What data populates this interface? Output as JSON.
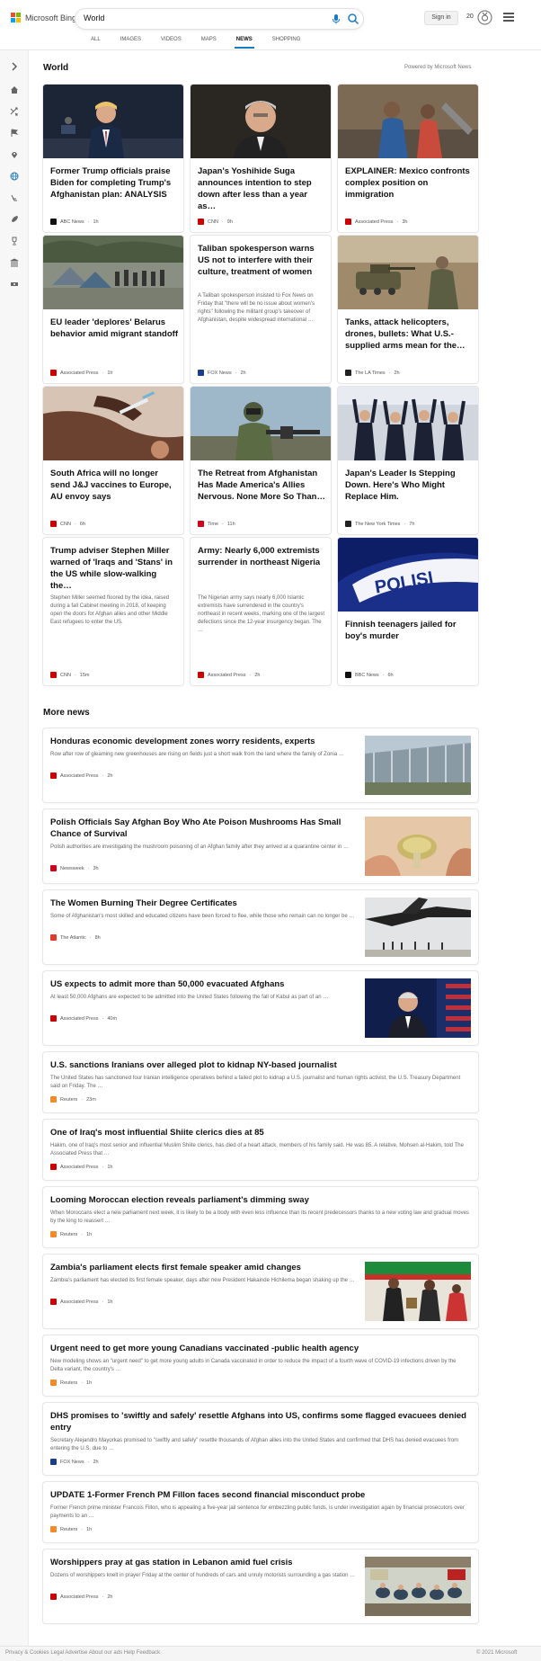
{
  "header": {
    "logo_text": "Microsoft Bing",
    "logo_colors": [
      "#f25022",
      "#7fba00",
      "#00a4ef",
      "#ffb900"
    ],
    "search_value": "World",
    "signin_label": "Sign in",
    "points": "20"
  },
  "tabs": [
    {
      "label": "ALL",
      "active": false
    },
    {
      "label": "IMAGES",
      "active": false
    },
    {
      "label": "VIDEOS",
      "active": false
    },
    {
      "label": "MAPS",
      "active": false
    },
    {
      "label": "NEWS",
      "active": true
    },
    {
      "label": "SHOPPING",
      "active": false
    }
  ],
  "rail_icons": [
    "chevron-right-icon",
    "home-icon",
    "shuffle-icon",
    "flag-icon",
    "location-icon",
    "globe-icon",
    "scale-icon",
    "rocket-icon",
    "trophy-icon",
    "landmark-icon",
    "money-icon"
  ],
  "section": {
    "title": "World",
    "powered": "Powered by Microsoft News"
  },
  "cards": [
    {
      "title": "Former Trump officials praise Biden for completing Trump's Afghanistan plan: ANALYSIS",
      "source": "ABC News",
      "time": "1h",
      "src_color": "#111111",
      "thumb": "trump"
    },
    {
      "title": "Japan's Yoshihide Suga announces intention to step down after less than a year as…",
      "source": "CNN",
      "time": "9h",
      "src_color": "#cc0000",
      "thumb": "suga"
    },
    {
      "title": "EXPLAINER: Mexico confronts complex position on immigration",
      "source": "Associated Press",
      "time": "3h",
      "src_color": "#cc0000",
      "thumb": "mexico"
    },
    {
      "title": "EU leader 'deplores' Belarus behavior amid migrant standoff",
      "source": "Associated Press",
      "time": "1h",
      "src_color": "#cc0000",
      "thumb": "belarus"
    },
    {
      "title": "Taliban spokesperson warns US not to interfere with their culture, treatment of women",
      "snippet": "A Taliban spokesperson insisted to Fox News on Friday that \"there will be no issue about women's rights\" following the militant group's takeover of Afghanistan, despite widespread international …",
      "source": "FOX News",
      "time": "2h",
      "src_color": "#1a3e8c",
      "thumb": ""
    },
    {
      "title": "Tanks, attack helicopters, drones, bullets: What U.S.-supplied arms mean for the…",
      "source": "The LA Times",
      "time": "2h",
      "src_color": "#222222",
      "thumb": "tanks"
    },
    {
      "title": "South Africa will no longer send J&J vaccines to Europe, AU envoy says",
      "source": "CNN",
      "time": "6h",
      "src_color": "#cc0000",
      "thumb": "vaccine"
    },
    {
      "title": "The Retreat from Afghanistan Has Made America's Allies Nervous. None More So Than…",
      "source": "Time",
      "time": "11h",
      "src_color": "#d0021b",
      "thumb": "soldier"
    },
    {
      "title": "Japan's Leader Is Stepping Down. Here's Who Might Replace Him.",
      "source": "The New York Times",
      "time": "7h",
      "src_color": "#222222",
      "thumb": "leaders"
    },
    {
      "title": "Trump adviser Stephen Miller warned of 'Iraqs and 'Stans' in the US while slow-walking the…",
      "snippet": "Stephen Miller seemed floored by the idea, raised during a fall Cabinet meeting in 2018, of keeping open the doors for Afghan allies and other Middle East refugees to enter the US.",
      "source": "CNN",
      "time": "15m",
      "src_color": "#cc0000",
      "thumb": ""
    },
    {
      "title": "Army: Nearly 6,000 extremists surrender in northeast Nigeria",
      "snippet": "The Nigerian army says nearly 6,000 Islamic extremists have surrendered in the country's northeast in recent weeks, marking one of the largest defections since the 12-year insurgency began. The …",
      "source": "Associated Press",
      "time": "2h",
      "src_color": "#cc0000",
      "thumb": ""
    },
    {
      "title": "Finnish teenagers jailed for boy's murder",
      "source": "BBC News",
      "time": "6h",
      "src_color": "#111111",
      "thumb": "polisi",
      "thumb_text": "POLISI"
    }
  ],
  "more_news_title": "More news",
  "more_news": [
    {
      "title": "Honduras economic development zones worry residents, experts",
      "snippet": "Row after row of gleaming new greenhouses are rising on fields just a short walk from the land where the family of Zonia …",
      "source": "Associated Press",
      "time": "2h",
      "src_color": "#cc0000",
      "thumb": "greenhouse"
    },
    {
      "title": "Polish Officials Say Afghan Boy Who Ate Poison Mushrooms Has Small Chance of Survival",
      "snippet": "Polish authorities are investigating the mushroom poisoning of an Afghan family after they arrived at a quarantine center in …",
      "source": "Newsweek",
      "time": "3h",
      "src_color": "#d0021b",
      "thumb": "mushroom"
    },
    {
      "title": "The Women Burning Their Degree Certificates",
      "snippet": "Some of Afghanistan's most skilled and educated citizens have been forced to flee, while those who remain can no longer be …",
      "source": "The Atlantic",
      "time": "8h",
      "src_color": "#e23b2e",
      "thumb": "plane"
    },
    {
      "title": "US expects to admit more than 50,000 evacuated Afghans",
      "snippet": "At least 50,000 Afghans are expected to be admitted into the United States following the fall of Kabul as part of an …",
      "source": "Associated Press",
      "time": "40m",
      "src_color": "#cc0000",
      "thumb": "mayorkas"
    },
    {
      "title": "U.S. sanctions Iranians over alleged plot to kidnap NY-based journalist",
      "snippet": "The United States has sanctioned four Iranian intelligence operatives behind a failed plot to kidnap a U.S. journalist and human rights activist, the U.S. Treasury Department said on Friday. The …",
      "source": "Reuters",
      "time": "23m",
      "src_color": "#f28c28",
      "thumb": ""
    },
    {
      "title": "One of Iraq's most influential Shiite clerics dies at 85",
      "snippet": "Hakim, one of Iraq's most senior and influential Muslim Shiite clerics, has died of a heart attack, members of his family said. He was 85. A relative, Mohsen al-Hakim, told The Associated Press that …",
      "source": "Associated Press",
      "time": "1h",
      "src_color": "#cc0000",
      "thumb": ""
    },
    {
      "title": "Looming Moroccan election reveals parliament's dimming sway",
      "snippet": "When Moroccans elect a new parliament next week, it is likely to be a body with even less influence than its recent predecessors thanks to a new voting law and gradual moves by the king to reassert …",
      "source": "Reuters",
      "time": "1h",
      "src_color": "#f28c28",
      "thumb": ""
    },
    {
      "title": "Zambia's parliament elects first female speaker amid changes",
      "snippet": "Zambia's parliament has elected its first female speaker, days after new President Hakainde Hichilema began shaking up the …",
      "source": "Associated Press",
      "time": "1h",
      "src_color": "#cc0000",
      "thumb": "zambia"
    },
    {
      "title": "Urgent need to get more young Canadians vaccinated -public health agency",
      "snippet": "New modeling shows an \"urgent need\" to get more young adults in Canada vaccinated in order to reduce the impact of a fourth wave of COVID-19 infections driven by the Delta variant, the country's …",
      "source": "Reuters",
      "time": "1h",
      "src_color": "#f28c28",
      "thumb": ""
    },
    {
      "title": "DHS promises to 'swiftly and safely' resettle Afghans into US, confirms some flagged evacuees denied entry",
      "snippet": "Secretary Alejandro Mayorkas promised to \"swiftly and safely\" resettle thousands of Afghan allies into the United States and confirmed that DHS has denied evacuees from entering the U.S. due to …",
      "source": "FOX News",
      "time": "2h",
      "src_color": "#1a3e8c",
      "thumb": ""
    },
    {
      "title": "UPDATE 1-Former French PM Fillon faces second financial misconduct probe",
      "snippet": "Former French prime minister Francois Fillon, who is appealing a five-year jail sentence for embezzling public funds, is under investigation again by financial prosecutors over payments to an …",
      "source": "Reuters",
      "time": "1h",
      "src_color": "#f28c28",
      "thumb": ""
    },
    {
      "title": "Worshippers pray at gas station in Lebanon amid fuel crisis",
      "snippet": "Dozens of worshippers knelt in prayer Friday at the center of hundreds of cars and unruly motorists surrounding a gas station …",
      "source": "Associated Press",
      "time": "2h",
      "src_color": "#cc0000",
      "thumb": "lebanon"
    }
  ],
  "footer": {
    "left": "Privacy & Cookies   Legal   Advertise   About our ads   Help   Feedback",
    "right": "© 2021 Microsoft"
  }
}
